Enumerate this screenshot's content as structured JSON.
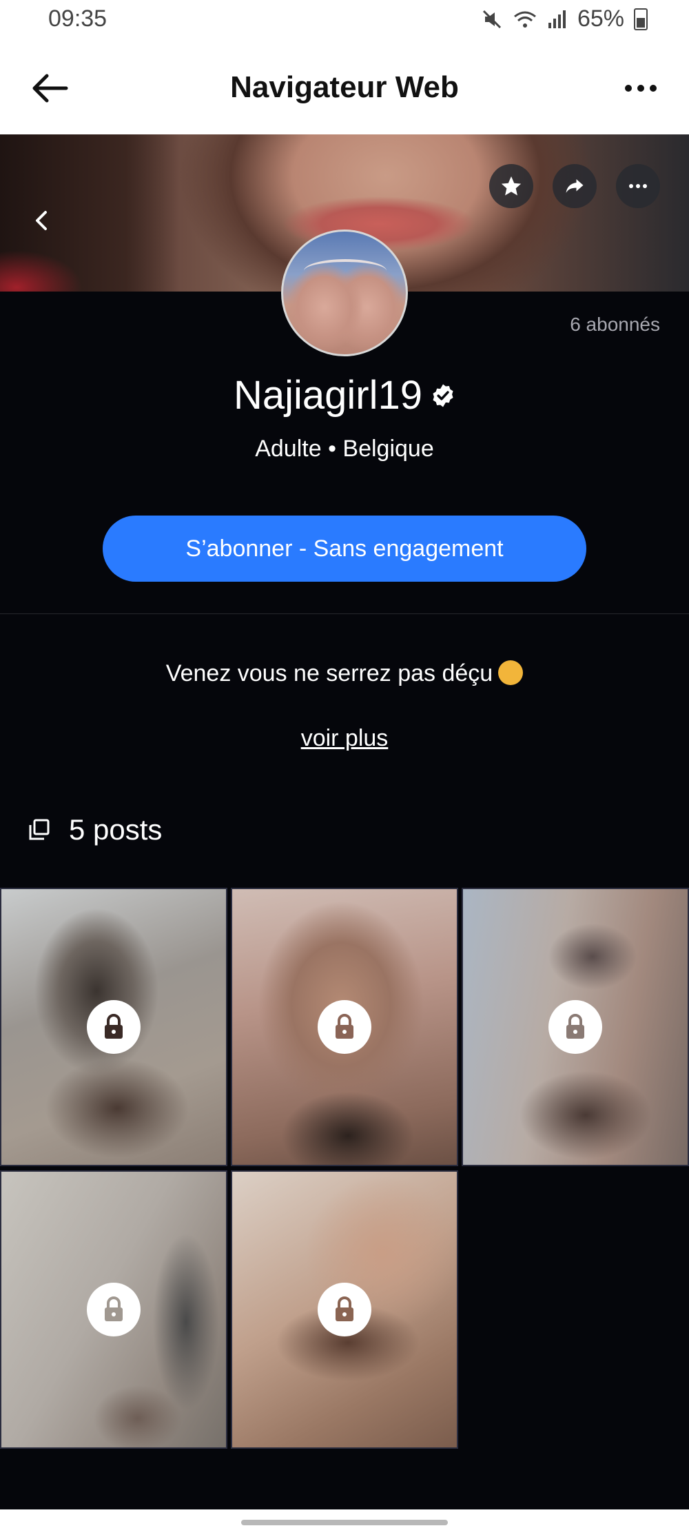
{
  "status_bar": {
    "time": "09:35",
    "battery": "65%"
  },
  "browser": {
    "title": "Navigateur Web"
  },
  "profile": {
    "followers": "6 abonnés",
    "username": "Najiagirl19",
    "subtitle": "Adulte • Belgique",
    "subscribe_label": "S’abonner - Sans engagement",
    "bio": "Venez vous ne serrez pas déçu",
    "see_more": "voir plus",
    "posts_label": "5 posts"
  },
  "colors": {
    "accent": "#2a7bff",
    "background": "#05060b"
  },
  "icons": {
    "back": "arrow-left-icon",
    "menu": "more-horizontal-icon",
    "favorite": "star-icon",
    "share": "share-arrow-icon",
    "options": "more-icon",
    "verified": "verified-badge-icon",
    "posts": "posts-stack-icon",
    "lock": "lock-icon"
  },
  "posts": [
    {
      "locked": true
    },
    {
      "locked": true
    },
    {
      "locked": true
    },
    {
      "locked": true
    },
    {
      "locked": true
    }
  ]
}
